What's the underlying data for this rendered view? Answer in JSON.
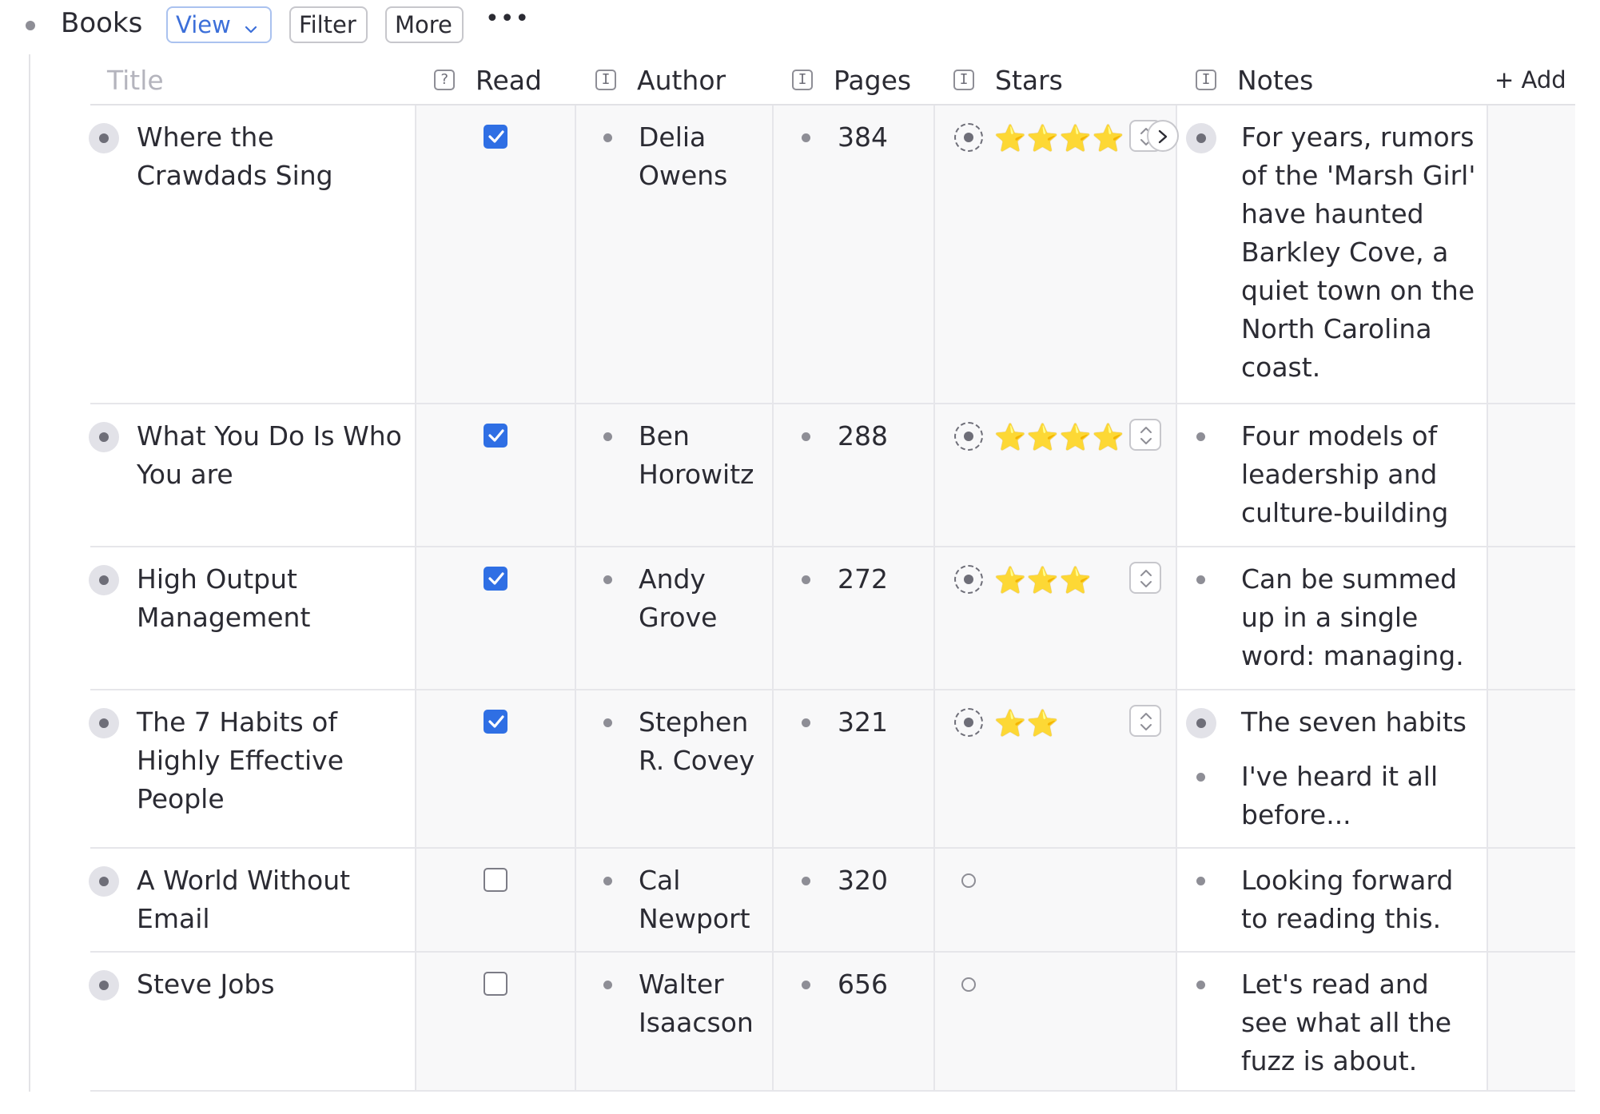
{
  "header": {
    "title": "Books",
    "view_label": "View",
    "filter_label": "Filter",
    "more_label": "More",
    "overflow_glyph": "•••"
  },
  "columns": {
    "title": "Title",
    "read": "Read",
    "author": "Author",
    "pages": "Pages",
    "stars": "Stars",
    "notes": "Notes",
    "add": "+ Add"
  },
  "column_icons": {
    "read": "?",
    "author": "I",
    "pages": "I",
    "stars": "I",
    "notes": "I"
  },
  "rows": [
    {
      "title_lines": [
        "Where the",
        "Crawdads Sing"
      ],
      "read": true,
      "author_lines": [
        "Delia",
        "Owens"
      ],
      "pages": "384",
      "stars": "⭐⭐⭐⭐",
      "star_count": 4,
      "notes": [
        {
          "lines": [
            "For years, rumors",
            "of the 'Marsh Girl'",
            "have haunted",
            "Barkley Cove, a",
            "quiet town on the",
            "North Carolina",
            "coast."
          ],
          "expandable": true
        }
      ]
    },
    {
      "title_lines": [
        "What You Do Is Who",
        "You are"
      ],
      "read": true,
      "author_lines": [
        "Ben",
        "Horowitz"
      ],
      "pages": "288",
      "stars": "⭐⭐⭐⭐",
      "star_count": 4,
      "notes": [
        {
          "lines": [
            "Four models of",
            "leadership and",
            "culture-building"
          ],
          "expandable": false
        }
      ]
    },
    {
      "title_lines": [
        "High Output",
        "Management"
      ],
      "read": true,
      "author_lines": [
        "Andy",
        "Grove"
      ],
      "pages": "272",
      "stars": "⭐⭐⭐",
      "star_count": 3,
      "notes": [
        {
          "lines": [
            "Can be summed",
            "up in a single",
            "word: managing."
          ],
          "expandable": false
        }
      ]
    },
    {
      "title_lines": [
        "The 7 Habits of",
        "Highly Effective",
        "People"
      ],
      "read": true,
      "author_lines": [
        "Stephen",
        "R. Covey"
      ],
      "pages": "321",
      "stars": "⭐⭐",
      "star_count": 2,
      "notes": [
        {
          "lines": [
            "The seven habits"
          ],
          "expandable": true
        },
        {
          "lines": [
            "I've heard it all",
            "before..."
          ],
          "expandable": false
        }
      ]
    },
    {
      "title_lines": [
        "A World Without",
        "Email"
      ],
      "read": false,
      "author_lines": [
        "Cal",
        "Newport"
      ],
      "pages": "320",
      "stars": "",
      "star_count": 0,
      "notes": [
        {
          "lines": [
            "Looking forward",
            "to reading this."
          ],
          "expandable": false
        }
      ]
    },
    {
      "title_lines": [
        "Steve Jobs"
      ],
      "read": false,
      "author_lines": [
        "Walter",
        "Isaacson"
      ],
      "pages": "656",
      "stars": "",
      "star_count": 0,
      "notes": [
        {
          "lines": [
            "Let's read and",
            "see what all the",
            "fuzz is about."
          ],
          "expandable": false
        }
      ]
    }
  ],
  "colors": {
    "accent": "#2f6fe4",
    "view_button": "#3c6fd9",
    "star": "#f5b400",
    "row_shade": "#f8f8f9",
    "border": "#e6e6ea"
  }
}
